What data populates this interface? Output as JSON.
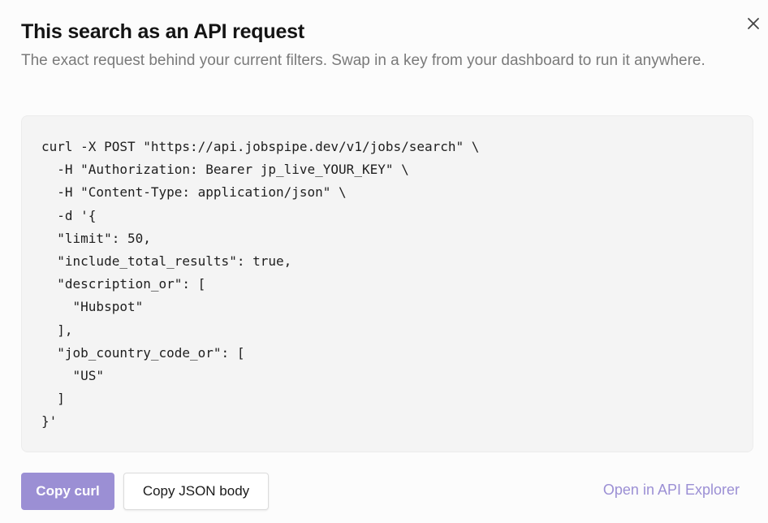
{
  "dialog": {
    "title": "This search as an API request",
    "subtitle": "The exact request behind your current filters. Swap in a key from your dashboard to run it anywhere.",
    "close_icon": "close-icon"
  },
  "code": {
    "text": "curl -X POST \"https://api.jobspipe.dev/v1/jobs/search\" \\\n  -H \"Authorization: Bearer jp_live_YOUR_KEY\" \\\n  -H \"Content-Type: application/json\" \\\n  -d '{\n  \"limit\": 50,\n  \"include_total_results\": true,\n  \"description_or\": [\n    \"Hubspot\"\n  ],\n  \"job_country_code_or\": [\n    \"US\"\n  ]\n}'"
  },
  "actions": {
    "copy_curl_label": "Copy curl",
    "copy_json_label": "Copy JSON body",
    "open_explorer_label": "Open in API Explorer"
  },
  "colors": {
    "accent": "#9b8fd4",
    "code_bg": "#f4f4f4",
    "muted_text": "#7a7a7a"
  }
}
